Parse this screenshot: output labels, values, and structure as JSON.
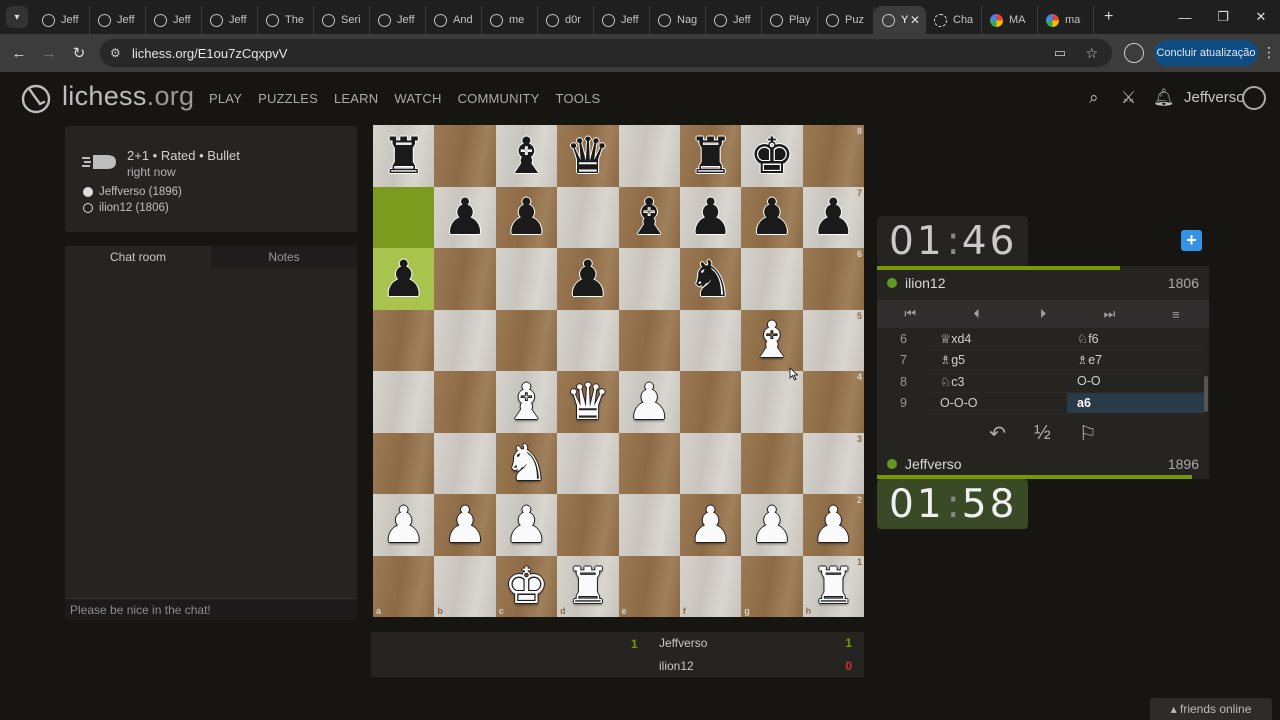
{
  "browser": {
    "tabs": [
      {
        "title": "Jeff",
        "icon": "lichess-icon"
      },
      {
        "title": "Jeff",
        "icon": "lichess-icon"
      },
      {
        "title": "Jeff",
        "icon": "lichess-icon"
      },
      {
        "title": "Jeff",
        "icon": "lichess-icon"
      },
      {
        "title": "The",
        "icon": "lichess-icon"
      },
      {
        "title": "Seri",
        "icon": "lichess-icon"
      },
      {
        "title": "Jeff",
        "icon": "lichess-icon"
      },
      {
        "title": "And",
        "icon": "lichess-icon"
      },
      {
        "title": "me",
        "icon": "lichess-icon"
      },
      {
        "title": "d0r",
        "icon": "lichess-icon"
      },
      {
        "title": "Jeff",
        "icon": "lichess-icon"
      },
      {
        "title": "Nag",
        "icon": "lichess-icon"
      },
      {
        "title": "Jeff",
        "icon": "lichess-icon"
      },
      {
        "title": "Play",
        "icon": "lichess-icon"
      },
      {
        "title": "Puz",
        "icon": "lichess-icon"
      },
      {
        "title": "Y",
        "icon": "lichess-icon",
        "active": true
      },
      {
        "title": "Cha",
        "icon": "chatgpt-icon"
      },
      {
        "title": "MA",
        "icon": "google-icon"
      },
      {
        "title": "ma",
        "icon": "google-icon"
      }
    ],
    "url": "lichess.org/E1ou7zCqxpvV",
    "update_button": "Concluir atualização"
  },
  "site": {
    "brand_main": "lichess",
    "brand_tld": ".org",
    "nav": [
      "PLAY",
      "PUZZLES",
      "LEARN",
      "WATCH",
      "COMMUNITY",
      "TOOLS"
    ],
    "username": "Jeffverso"
  },
  "game_info": {
    "type": "2+1 • Rated • Bullet",
    "time": "right now",
    "white_player": "Jeffverso (1896)",
    "black_player": "ilion12 (1806)"
  },
  "chat": {
    "tab_chat": "Chat room",
    "tab_notes": "Notes",
    "placeholder": "Please be nice in the chat!"
  },
  "board": {
    "orientation": "white",
    "highlight_squares": [
      "a7",
      "a6"
    ],
    "ranks": [
      "8",
      "7",
      "6",
      "5",
      "4",
      "3",
      "2",
      "1"
    ],
    "files": [
      "a",
      "b",
      "c",
      "d",
      "e",
      "f",
      "g",
      "h"
    ],
    "pieces": {
      "a8": "bR",
      "c8": "bB",
      "d8": "bQ",
      "f8": "bR",
      "g8": "bK",
      "b7": "bP",
      "c7": "bP",
      "e7": "bB",
      "f7": "bP",
      "g7": "bP",
      "h7": "bP",
      "a6": "bP",
      "d6": "bP",
      "f6": "bN",
      "g5": "wB",
      "c4": "wB",
      "d4": "wQ",
      "e4": "wP",
      "c3": "wN",
      "a2": "wP",
      "b2": "wP",
      "c2": "wP",
      "f2": "wP",
      "g2": "wP",
      "h2": "wP",
      "c1": "wK",
      "d1": "wR",
      "h1": "wR"
    }
  },
  "score": {
    "rows": [
      {
        "left": "1",
        "name": "Jeffverso",
        "score": "1",
        "color": "#759900"
      },
      {
        "left": "",
        "name": "ilion12",
        "score": "0",
        "color": "#cc3333"
      }
    ]
  },
  "clocks": {
    "top": {
      "min": "01",
      "sec": "46"
    },
    "bottom": {
      "min": "01",
      "sec": "58"
    },
    "top_fraction": 0.86,
    "bottom_fraction": 0.95
  },
  "players": {
    "top": {
      "name": "ilion12",
      "rating": "1806"
    },
    "bottom": {
      "name": "Jeffverso",
      "rating": "1896"
    }
  },
  "moves": [
    {
      "n": "6",
      "white": "♕xd4",
      "black": "♘f6"
    },
    {
      "n": "7",
      "white": "♗g5",
      "black": "♗e7"
    },
    {
      "n": "8",
      "white": "♘c3",
      "black": "O-O"
    },
    {
      "n": "9",
      "white": "O-O-O",
      "black": "a6",
      "active": "black"
    }
  ],
  "controls": {
    "first": "⏮",
    "prev": "⏴",
    "next": "⏵",
    "last": "⏭",
    "menu": "≡",
    "takeback": "↶",
    "draw": "½",
    "resign": "⚐"
  },
  "friends": "friends online"
}
